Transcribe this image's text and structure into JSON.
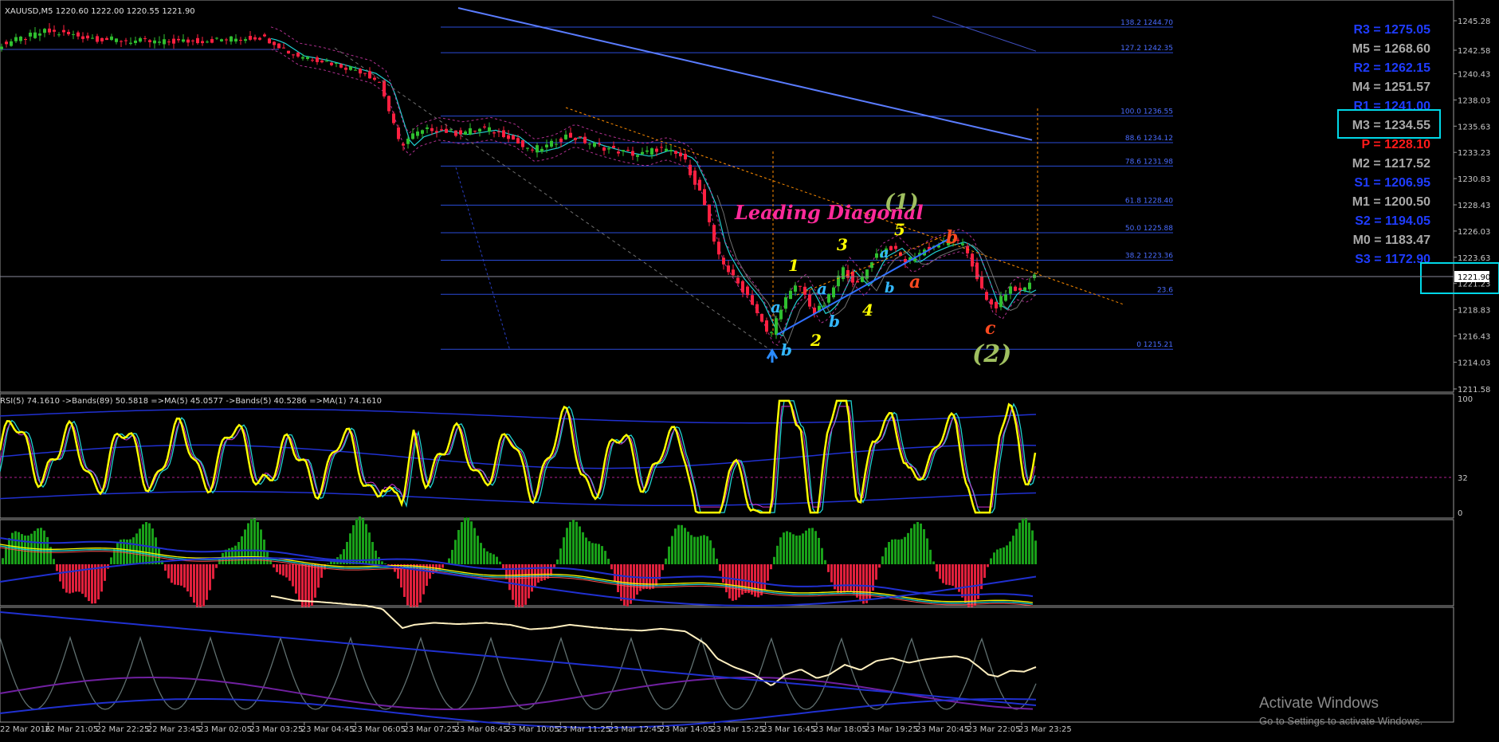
{
  "chart_data": {
    "type": "line",
    "symbol_header": "XAUUSD,M5 1220.60 1222.00 1220.55 1221.90",
    "price_axis_ticks": [
      "1245.28",
      "1242.58",
      "1240.43",
      "1238.03",
      "1235.63",
      "1233.23",
      "1230.83",
      "1228.43",
      "1226.03",
      "1223.63",
      "1221.23",
      "1218.83",
      "1216.43",
      "1214.03",
      "1211.58"
    ],
    "current_price": "1221.90",
    "time_axis_ticks": [
      "22 Mar 2016",
      "22 Mar 21:05",
      "22 Mar 22:25",
      "22 Mar 23:45",
      "23 Mar 02:05",
      "23 Mar 03:25",
      "23 Mar 04:45",
      "23 Mar 06:05",
      "23 Mar 07:25",
      "23 Mar 08:45",
      "23 Mar 10:05",
      "23 Mar 11:25",
      "23 Mar 12:45",
      "23 Mar 14:05",
      "23 Mar 15:25",
      "23 Mar 16:45",
      "23 Mar 18:05",
      "23 Mar 19:25",
      "23 Mar 20:45",
      "23 Mar 22:05",
      "23 Mar 23:25"
    ],
    "fib_levels": [
      {
        "label": "138.2 1244.70",
        "value": 1244.7
      },
      {
        "label": "127.2 1242.35",
        "value": 1242.35
      },
      {
        "label": "100.0 1236.55",
        "value": 1236.55
      },
      {
        "label": "88.6 1234.12",
        "value": 1234.12
      },
      {
        "label": "78.6 1231.98",
        "value": 1231.98
      },
      {
        "label": "61.8 1228.40",
        "value": 1228.4
      },
      {
        "label": "50.0 1225.88",
        "value": 1225.88
      },
      {
        "label": "38.2 1223.36",
        "value": 1223.36
      },
      {
        "label": "23.6",
        "value": 1220.24
      },
      {
        "label": "0 1215.21",
        "value": 1215.21
      }
    ],
    "pivots": [
      {
        "label": "R3 = 1275.05",
        "color": "#1f3cff"
      },
      {
        "label": "M5 = 1268.60",
        "color": "#a8a8a8"
      },
      {
        "label": "R2 = 1262.15",
        "color": "#1f3cff"
      },
      {
        "label": "M4 = 1251.57",
        "color": "#a8a8a8"
      },
      {
        "label": "R1 = 1241.00",
        "color": "#1f3cff"
      },
      {
        "label": "M3 = 1234.55",
        "color": "#a8a8a8"
      },
      {
        "label": "P  = 1228.10",
        "color": "#ff1a1a"
      },
      {
        "label": "M2 = 1217.52",
        "color": "#a8a8a8"
      },
      {
        "label": "S1 = 1206.95",
        "color": "#1f3cff"
      },
      {
        "label": "M1 = 1200.50",
        "color": "#a8a8a8"
      },
      {
        "label": "S2 = 1194.05",
        "color": "#1f3cff"
      },
      {
        "label": "M0 = 1183.47",
        "color": "#a8a8a8"
      },
      {
        "label": "S3 = 1172.90",
        "color": "#1f3cff"
      }
    ],
    "annotation_title": "Leading Diagonal",
    "wave_labels": {
      "w1": "(1)",
      "w2": "(2)",
      "n1": "1",
      "n2": "2",
      "n3": "3",
      "n4": "4",
      "n5": "5",
      "a": "a",
      "b": "b",
      "c": "c"
    },
    "rsi_header": "RSI(5) 74.1610 ->Bands(89) 50.5818 =>MA(5) 45.0577 ->Bands(5) 40.5286 =>MA(1) 74.1610",
    "rsi_ticks": [
      "100",
      "32",
      "0"
    ]
  },
  "watermark": {
    "title": "Activate Windows",
    "subtitle": "Go to Settings to activate Windows."
  },
  "colors": {
    "bull_candle": "#2fbf2f",
    "bear_candle": "#ff2040",
    "fib_line": "#2a4bd8",
    "accent_box": "#00d8e8",
    "rsi_line": "#ffff00",
    "ma_line": "#20d0d0",
    "hist_up": "#19a019",
    "hist_down": "#e0203c"
  }
}
